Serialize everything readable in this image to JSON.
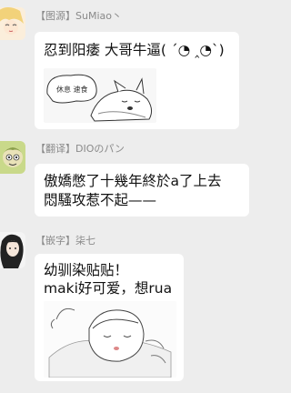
{
  "messages": [
    {
      "sender": "【图源】SuMiao丶",
      "lines": [
        "忍到阳痿 大哥牛逼( ´◔ ‸◔`)"
      ],
      "sticker": {
        "caption": "休息 速食",
        "icon": "dog-sleeping-sticker"
      }
    },
    {
      "sender": "【翻译】DIOのパン",
      "lines": [
        "傲嬌憋了十幾年終於a了上去",
        "悶騷攻惹不起——"
      ]
    },
    {
      "sender": "【嵌字】柒七",
      "lines": [
        "幼驯染贴贴！",
        "maki好可爱，想rua"
      ],
      "sticker": {
        "icon": "child-sleeping-sticker"
      }
    }
  ],
  "colors": {
    "background": "#ededed",
    "bubble": "#ffffff",
    "sender": "#8a8a8a"
  }
}
